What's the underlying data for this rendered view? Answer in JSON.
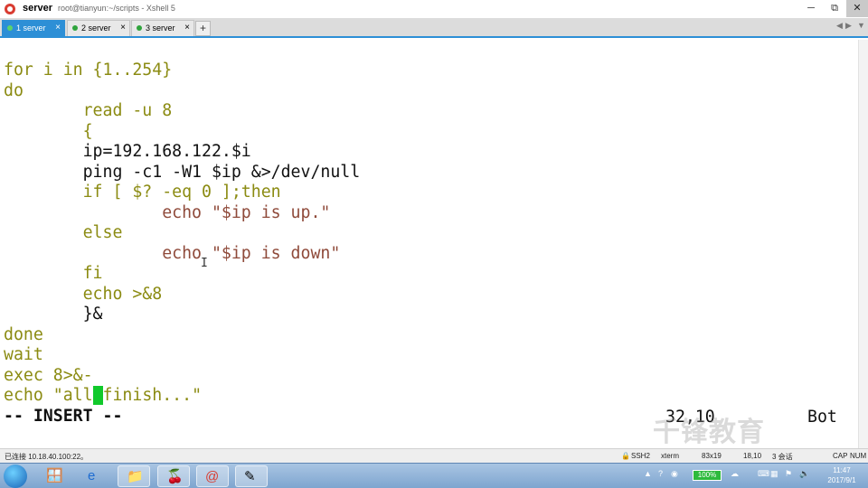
{
  "window": {
    "session_name": "server",
    "path_title": "root@tianyun:~/scripts - Xshell 5",
    "minimize": "─",
    "maximize": "⧉",
    "close": "✕"
  },
  "tabs": [
    {
      "label": "1 server",
      "active": true
    },
    {
      "label": "2 server",
      "active": false
    },
    {
      "label": "3 server",
      "active": false
    }
  ],
  "tab_add": "+",
  "tab_prev": "◀",
  "tab_next": "▶",
  "tab_menu": "▼",
  "terminal": {
    "lines": [
      "for i in {1..254}",
      "do",
      "        read -u 8",
      "        {",
      "        ip=192.168.122.$i",
      "        ping -c1 -W1 $ip &>/dev/null",
      "        if [ $? -eq 0 ];then",
      "                echo \"$ip is up.\"",
      "        else",
      "                echo \"$ip is down\"",
      "        fi",
      "        echo >&8",
      "        }&",
      "done",
      "wait",
      "exec 8>&-",
      "echo \"all finish...\""
    ],
    "mode": "-- INSERT --",
    "cursor_pos": "32,10",
    "scroll_pos": "Bot",
    "watermark": "千锋教育"
  },
  "status": {
    "connection": "已连接 10.18.40.100:22。",
    "protocol": "SSH2",
    "terminal_type": "xterm",
    "size": "83x19",
    "cursor": "18,10",
    "sessions": "3 会话",
    "caps": "CAP",
    "num": "NUM"
  },
  "taskbar": {
    "battery": "100%",
    "time": "11:47",
    "date": "2017/9/1"
  },
  "colors": {
    "tab_active": "#2d8fd6",
    "keyword": "#8b8b12",
    "number_string": "#8f4a3a",
    "variable": "#7a3a86",
    "cyan": "#1f96a8",
    "cursor": "#11c92b"
  }
}
